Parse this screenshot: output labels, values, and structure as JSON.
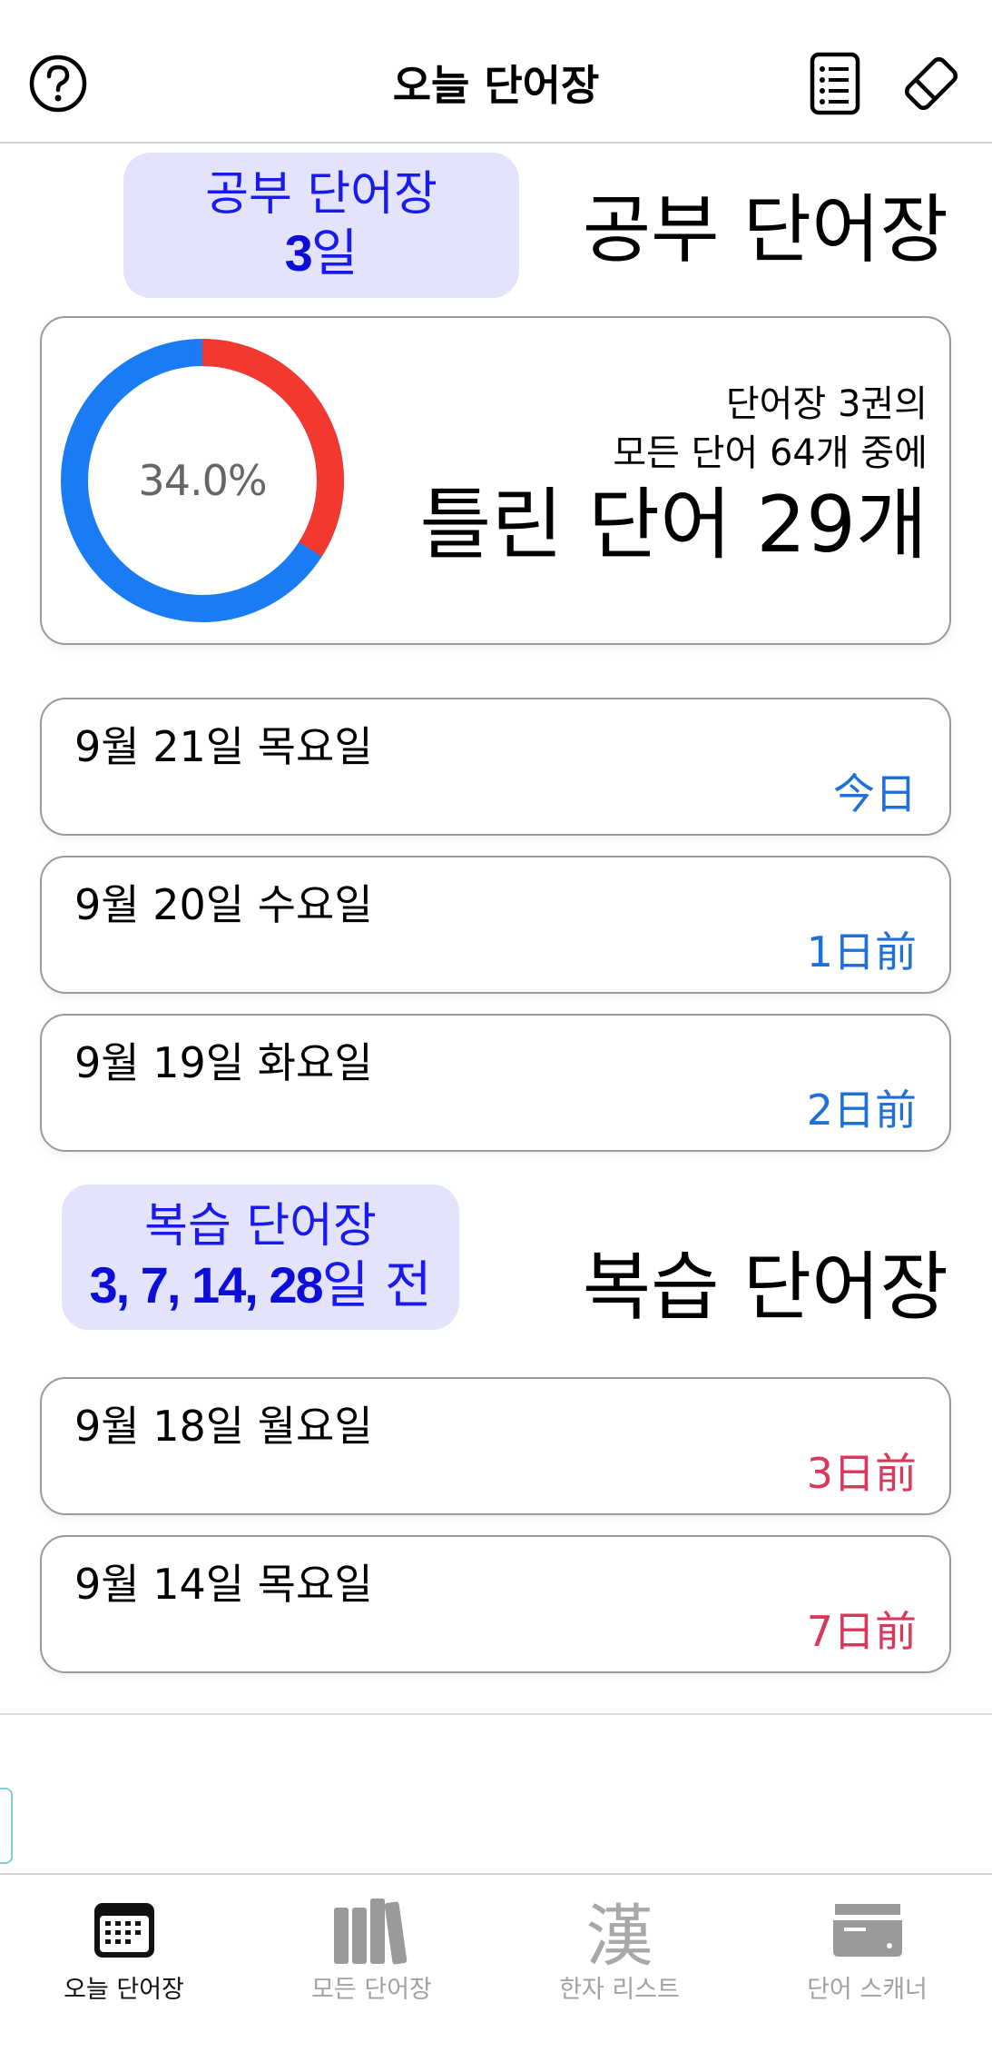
{
  "navbar": {
    "title": "오늘 단어장",
    "icons": [
      "help-icon",
      "note-list-icon",
      "eraser-icon"
    ]
  },
  "study": {
    "chip_label": "공부 단어장",
    "chip_days_num": "3",
    "chip_days_unit": "일",
    "section_title": "공부 단어장",
    "summary": {
      "line1": "단어장 3권의",
      "line2": "모든 단어 64개 중에",
      "big": "틀린 단어 29개",
      "percent_label": "34.0%",
      "wrong_fraction": 0.34,
      "wrong_color": "#f2382f",
      "right_color": "#1a7cf5"
    },
    "days": [
      {
        "date": "9월 21일 목요일",
        "ago": "今日"
      },
      {
        "date": "9월 20일 수요일",
        "ago": "1日前"
      },
      {
        "date": "9월 19일 화요일",
        "ago": "2日前"
      }
    ]
  },
  "review": {
    "chip_label": "복습 단어장",
    "chip_days_num": "3, 7, 14, 28",
    "chip_days_unit": "일 전",
    "section_title": "복습 단어장",
    "days": [
      {
        "date": "9월 18일 월요일",
        "ago": "3日前"
      },
      {
        "date": "9월 14일 목요일",
        "ago": "7日前"
      }
    ]
  },
  "tabbar": {
    "tabs": [
      {
        "label": "오늘 단어장",
        "icon": "calendar-icon",
        "active": true
      },
      {
        "label": "모든 단어장",
        "icon": "books-icon",
        "active": false
      },
      {
        "label": "한자 리스트",
        "icon": "kanji-icon",
        "glyph": "漢",
        "active": false
      },
      {
        "label": "단어 스캐너",
        "icon": "scanner-icon",
        "active": false
      }
    ]
  },
  "colors": {
    "accent_blue": "#1f6fd8",
    "accent_red": "#d8385a",
    "chip_bg": "#e3e4fb",
    "chip_text": "#1a1aee"
  }
}
